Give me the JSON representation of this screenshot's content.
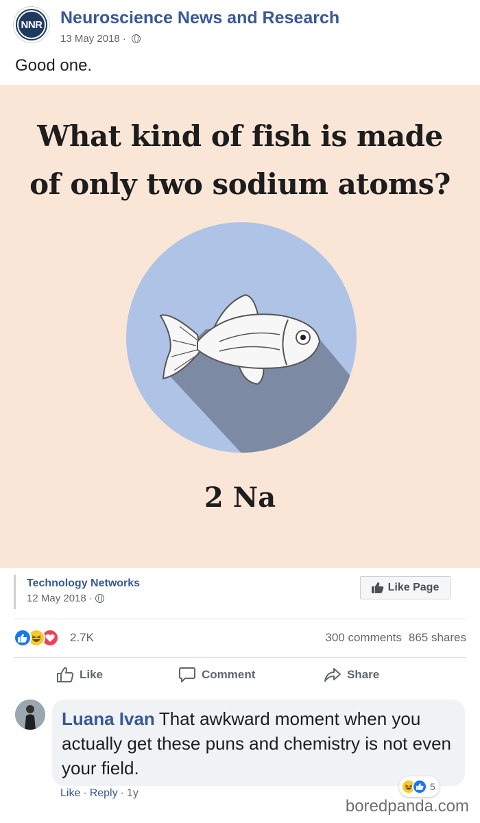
{
  "post": {
    "page_name": "Neuroscience News and Research",
    "avatar_text": "NNR",
    "date": "13 May 2018",
    "separator": "·",
    "text": "Good one."
  },
  "image": {
    "headline_line1": "What kind of fish is made",
    "headline_line2": "of only two sodium atoms?",
    "answer": "2 Na",
    "colors": {
      "background": "#fae6d7",
      "circle": "#aec3e6",
      "shadow": "#7c8aa3"
    }
  },
  "shared": {
    "page_name": "Technology Networks",
    "date": "12 May 2018",
    "separator": "·",
    "like_page_label": "Like Page"
  },
  "stats": {
    "reactions_count": "2.7K",
    "comments": "300 comments",
    "shares": "865 shares"
  },
  "actions": {
    "like": "Like",
    "comment": "Comment",
    "share": "Share"
  },
  "comment": {
    "author": "Luana Ivan",
    "text": "That awkward moment when you actually get these puns and chemistry is not even your field.",
    "like": "Like",
    "reply": "Reply",
    "age": "1y",
    "separator": "·",
    "reactions_count": "5"
  },
  "watermark": "boredpanda.com",
  "colors": {
    "link": "#385898",
    "meta": "#606770"
  }
}
